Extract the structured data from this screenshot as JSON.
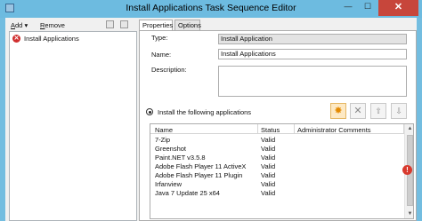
{
  "window": {
    "title": "Install Applications Task Sequence Editor",
    "minimize_glyph": "—",
    "maximize_glyph": "☐",
    "close_glyph": "✕"
  },
  "left_pane": {
    "add_hotkey": "A",
    "add_rest": "dd",
    "add_arrow": "▾",
    "remove_hotkey": "R",
    "remove_rest": "emove",
    "tree": [
      {
        "label": "Install Applications",
        "icon": "error-icon",
        "glyph": "✕"
      }
    ]
  },
  "tabs": [
    {
      "label": "Properties",
      "active": true
    },
    {
      "label": "Options",
      "active": false
    }
  ],
  "properties": {
    "type_label": "Type:",
    "type_value": "Install Application",
    "name_label": "Name:",
    "name_value": "Install Applications",
    "description_label": "Description:",
    "description_value": "",
    "radio_label": "Install the following applications",
    "add_app_glyph": "✸",
    "remove_app_glyph": "✕",
    "btn3_glyph": "⇧",
    "btn4_glyph": "⇩"
  },
  "app_list": {
    "columns": [
      "Name",
      "Status",
      "Administrator Comments"
    ],
    "rows": [
      {
        "name": "7-Zip",
        "status": "Valid"
      },
      {
        "name": "Greenshot",
        "status": "Valid"
      },
      {
        "name": "Paint.NET v3.5.8",
        "status": "Valid"
      },
      {
        "name": "Adobe Flash Player 11 ActiveX",
        "status": "Valid"
      },
      {
        "name": "Adobe Flash Player 11 Plugin",
        "status": "Valid"
      },
      {
        "name": "Irfanview",
        "status": "Valid"
      },
      {
        "name": "Java 7 Update 25 x64",
        "status": "Valid"
      }
    ],
    "scroll_up": "▲",
    "scroll_down": "▼"
  },
  "warning_glyph": "!",
  "colors": {
    "title_bar": "#6dbbe0",
    "close_button": "#c7463b",
    "error_red": "#d02e2e",
    "add_highlight": "#fde9c4"
  }
}
